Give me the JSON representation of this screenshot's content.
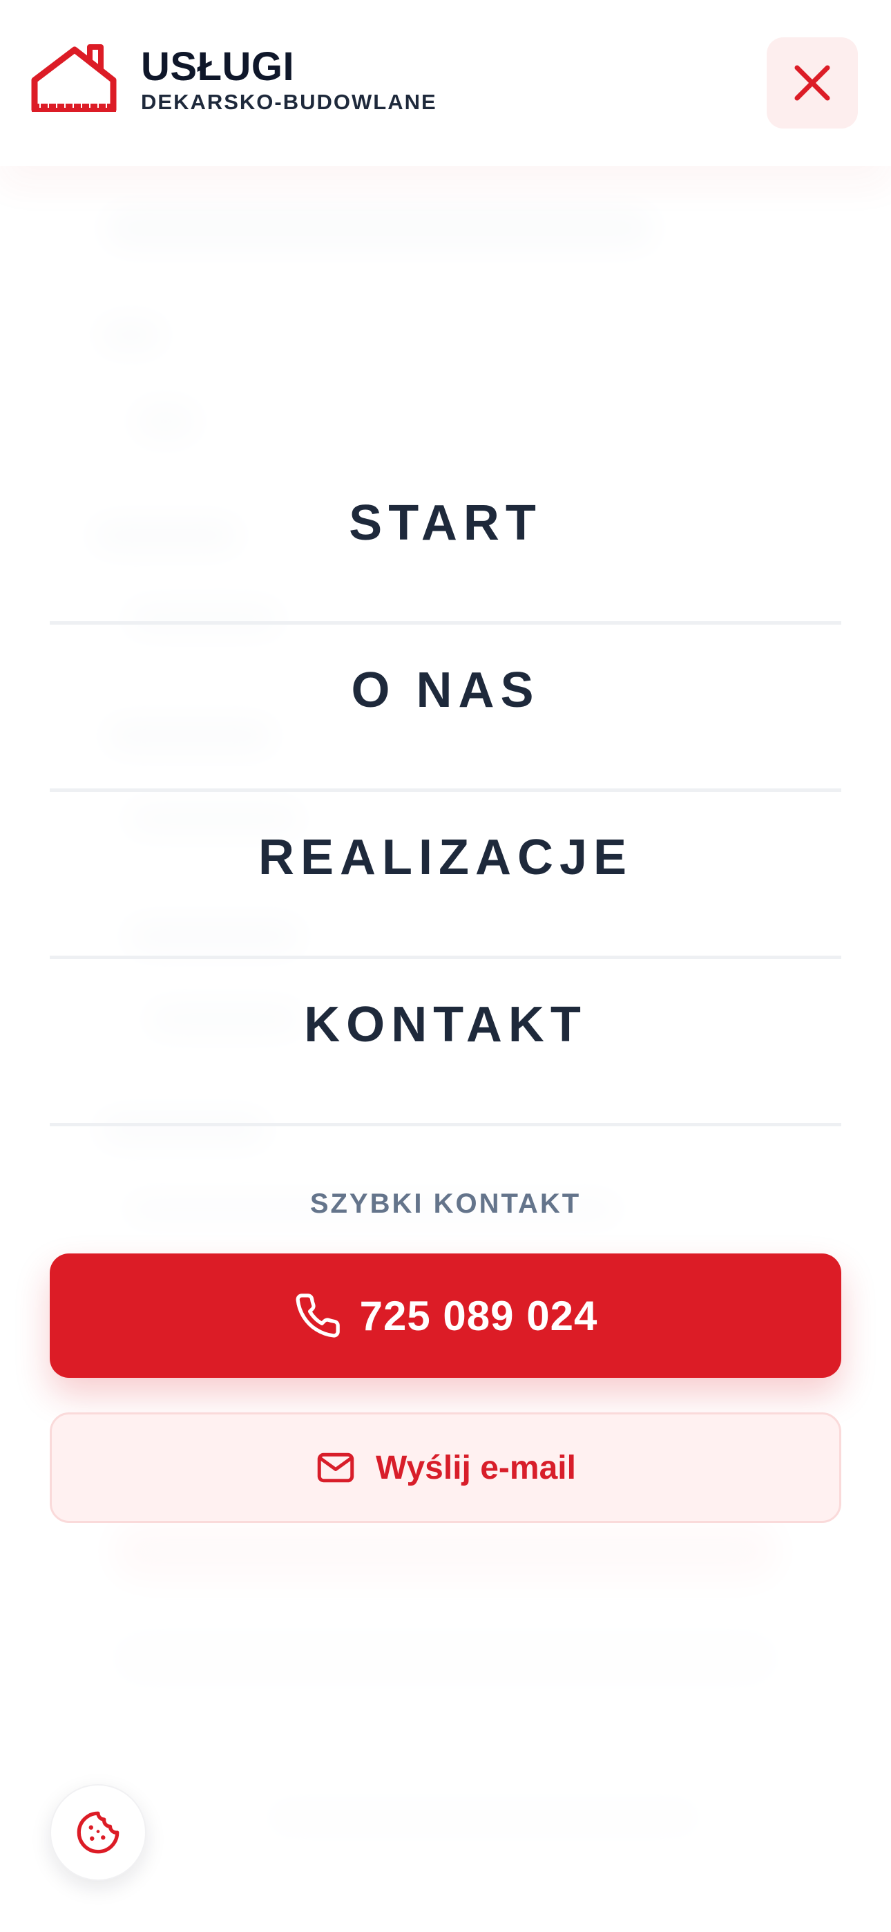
{
  "header": {
    "brand_title": "USŁUGI",
    "brand_subtitle": "DEKARSKO-BUDOWLANE",
    "logo_icon": "house-roof-icon",
    "close_icon": "close-icon"
  },
  "nav": {
    "items": [
      {
        "label": "START"
      },
      {
        "label": "O NAS"
      },
      {
        "label": "REALIZACJE"
      },
      {
        "label": "KONTAKT"
      }
    ]
  },
  "quick_contact": {
    "heading": "SZYBKI KONTAKT",
    "phone_label": "725 089 024",
    "phone_icon": "phone-icon",
    "email_label": "Wyślij e-mail",
    "email_icon": "mail-icon"
  },
  "cookie": {
    "icon": "cookie-icon"
  },
  "colors": {
    "accent": "#dc1c26",
    "text_dark": "#1e293b",
    "text_muted": "#64748b",
    "accent_soft": "#fdeeee"
  }
}
